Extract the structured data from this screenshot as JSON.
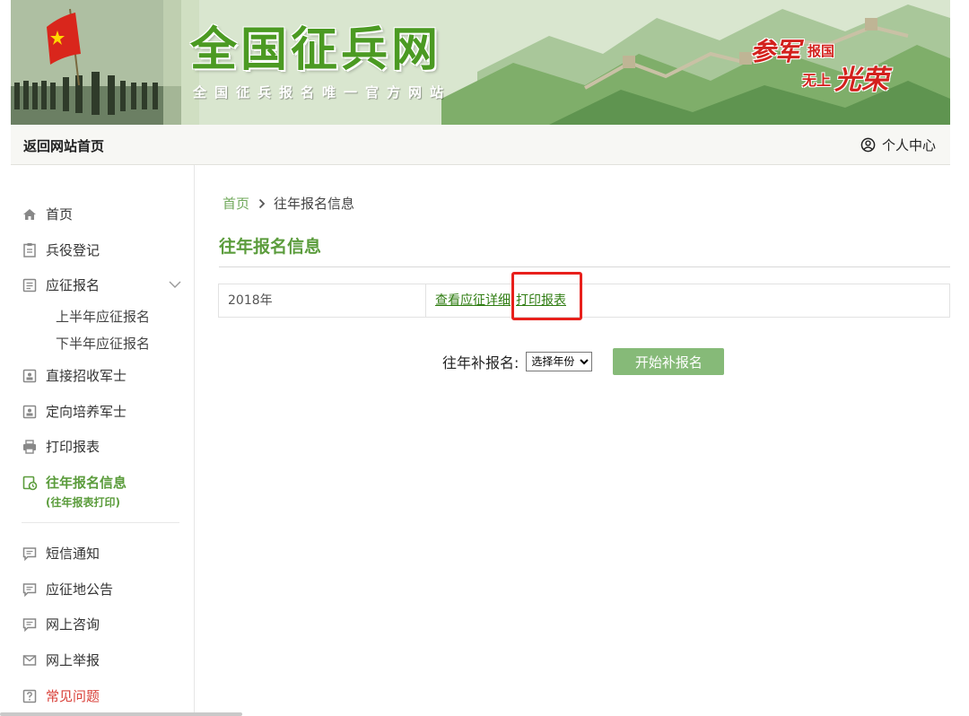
{
  "banner": {
    "title": "全国征兵网",
    "subtitle": "全国征兵报名唯一官方网站",
    "slogan": {
      "part1": "参军",
      "part2": "报国",
      "part3": "无上",
      "part4": "光荣"
    }
  },
  "topbar": {
    "home_link": "返回网站首页",
    "user_center": "个人中心"
  },
  "sidebar": {
    "items": [
      {
        "label": "首页",
        "icon": "home-icon"
      },
      {
        "label": "兵役登记",
        "icon": "clipboard-icon"
      },
      {
        "label": "应征报名",
        "icon": "form-icon",
        "expanded": true
      },
      {
        "label": "直接招收军士",
        "icon": "id-card-icon"
      },
      {
        "label": "定向培养军士",
        "icon": "id-card-icon"
      },
      {
        "label": "打印报表",
        "icon": "printer-icon"
      },
      {
        "label": "往年报名信息",
        "icon": "history-icon",
        "active": true
      },
      {
        "label": "短信通知",
        "icon": "message-icon"
      },
      {
        "label": "应征地公告",
        "icon": "message-icon"
      },
      {
        "label": "网上咨询",
        "icon": "message-icon"
      },
      {
        "label": "网上举报",
        "icon": "mail-icon"
      },
      {
        "label": "常见问题",
        "icon": "question-icon"
      }
    ],
    "sub_items": [
      "上半年应征报名",
      "下半年应征报名"
    ],
    "active_note": "(往年报表打印)"
  },
  "breadcrumb": {
    "home": "首页",
    "current": "往年报名信息"
  },
  "main": {
    "title": "往年报名信息",
    "records": [
      {
        "year": "2018年",
        "view_link": "查看应征详细",
        "print_link": "打印报表"
      }
    ],
    "makeup": {
      "label": "往年补报名:",
      "select_value": "选择年份",
      "button": "开始补报名"
    }
  },
  "colors": {
    "accent_green": "#5b9c3c",
    "link_green": "#2f7d12",
    "button_green": "#86ba78",
    "highlight_red": "#e8201c",
    "danger_red": "#d9413a"
  }
}
